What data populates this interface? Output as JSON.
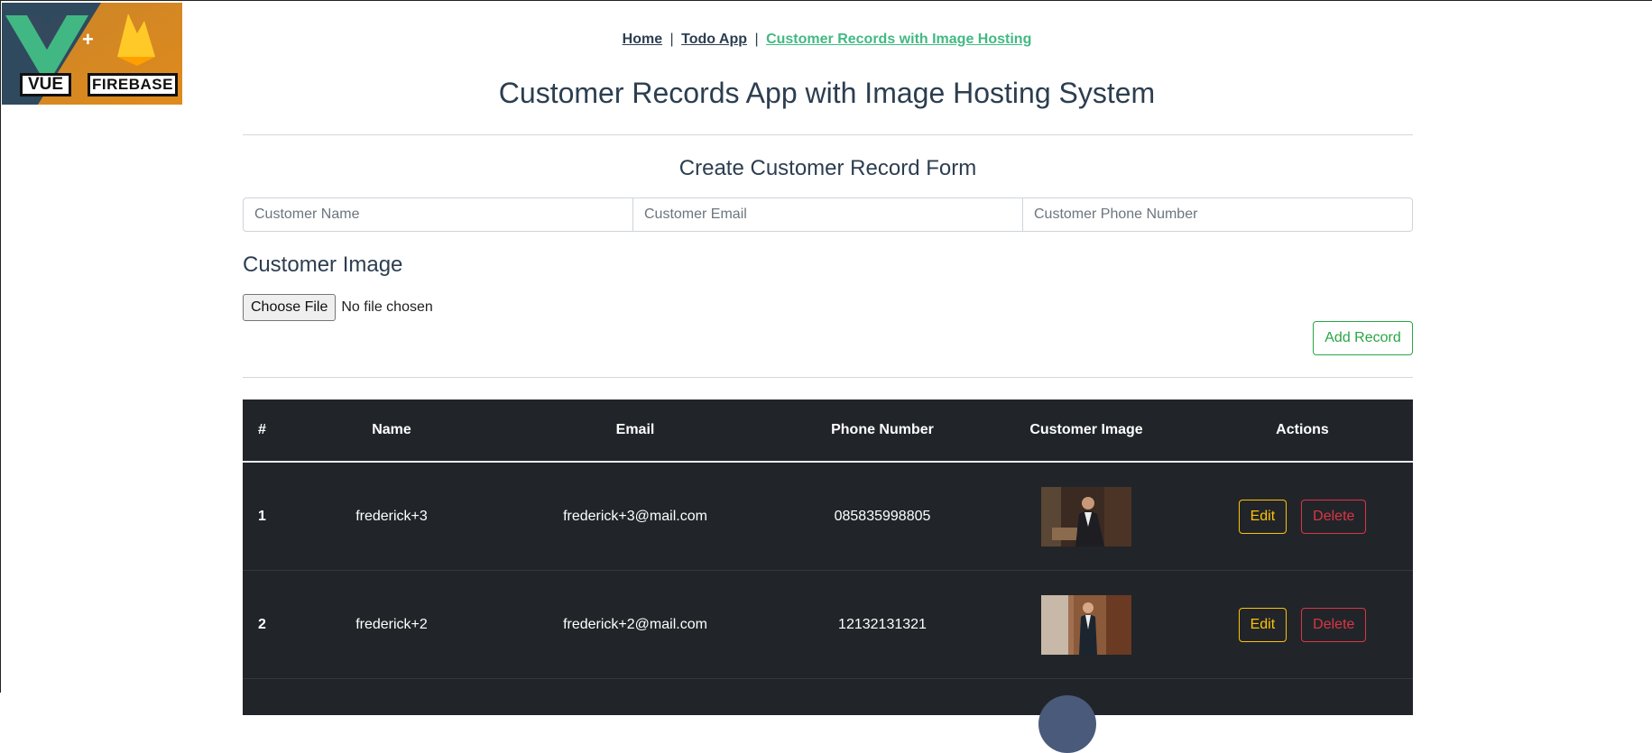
{
  "nav": {
    "home": "Home",
    "todo": "Todo App",
    "customers": "Customer Records with Image Hosting",
    "separator": "|"
  },
  "logo": {
    "vue_label": "VUE",
    "firebase_label": "FIREBASE",
    "plus": "+"
  },
  "page_title": "Customer Records App with Image Hosting System",
  "form": {
    "title": "Create Customer Record Form",
    "name_placeholder": "Customer Name",
    "email_placeholder": "Customer Email",
    "phone_placeholder": "Customer Phone Number",
    "image_title": "Customer Image",
    "file_button": "Choose File",
    "file_status": "No file chosen",
    "add_button": "Add Record"
  },
  "table": {
    "headers": [
      "#",
      "Name",
      "Email",
      "Phone Number",
      "Customer Image",
      "Actions"
    ],
    "rows": [
      {
        "index": "1",
        "name": "frederick+3",
        "email": "frederick+3@mail.com",
        "phone": "085835998805"
      },
      {
        "index": "2",
        "name": "frederick+2",
        "email": "frederick+2@mail.com",
        "phone": "12132131321"
      }
    ],
    "edit_label": "Edit",
    "delete_label": "Delete"
  },
  "colors": {
    "accent": "#42b983",
    "text": "#2c3e50",
    "table_bg": "#212529",
    "edit": "#ffc107",
    "delete": "#dc3545",
    "add": "#28a745"
  }
}
